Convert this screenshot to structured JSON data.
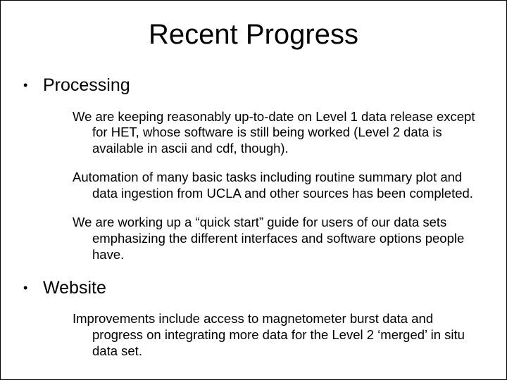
{
  "title": "Recent Progress",
  "sections": [
    {
      "heading": "Processing",
      "items": [
        "We are keeping reasonably up-to-date on Level 1 data release except for HET, whose software is still being worked (Level 2 data is available in ascii and cdf, though).",
        "Automation of many basic tasks including routine summary plot and data ingestion from UCLA and other sources has been completed.",
        "We are working up a “quick start” guide for users of our data sets emphasizing the different interfaces and software options people have."
      ]
    },
    {
      "heading": "Website",
      "items": [
        "Improvements include access to magnetometer burst data and progress on integrating more data for the Level 2 ‘merged’ in situ data set."
      ]
    }
  ]
}
